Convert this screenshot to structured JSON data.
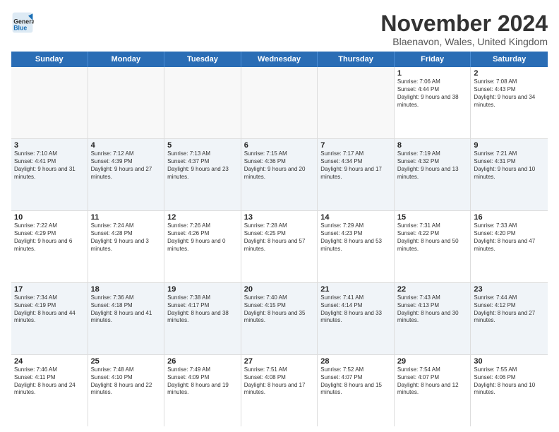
{
  "header": {
    "logo": {
      "general": "General",
      "blue": "Blue"
    },
    "title": "November 2024",
    "location": "Blaenavon, Wales, United Kingdom"
  },
  "calendar": {
    "days": [
      "Sunday",
      "Monday",
      "Tuesday",
      "Wednesday",
      "Thursday",
      "Friday",
      "Saturday"
    ],
    "weeks": [
      [
        {
          "day": "",
          "text": ""
        },
        {
          "day": "",
          "text": ""
        },
        {
          "day": "",
          "text": ""
        },
        {
          "day": "",
          "text": ""
        },
        {
          "day": "",
          "text": ""
        },
        {
          "day": "1",
          "text": "Sunrise: 7:06 AM\nSunset: 4:44 PM\nDaylight: 9 hours and 38 minutes."
        },
        {
          "day": "2",
          "text": "Sunrise: 7:08 AM\nSunset: 4:43 PM\nDaylight: 9 hours and 34 minutes."
        }
      ],
      [
        {
          "day": "3",
          "text": "Sunrise: 7:10 AM\nSunset: 4:41 PM\nDaylight: 9 hours and 31 minutes."
        },
        {
          "day": "4",
          "text": "Sunrise: 7:12 AM\nSunset: 4:39 PM\nDaylight: 9 hours and 27 minutes."
        },
        {
          "day": "5",
          "text": "Sunrise: 7:13 AM\nSunset: 4:37 PM\nDaylight: 9 hours and 23 minutes."
        },
        {
          "day": "6",
          "text": "Sunrise: 7:15 AM\nSunset: 4:36 PM\nDaylight: 9 hours and 20 minutes."
        },
        {
          "day": "7",
          "text": "Sunrise: 7:17 AM\nSunset: 4:34 PM\nDaylight: 9 hours and 17 minutes."
        },
        {
          "day": "8",
          "text": "Sunrise: 7:19 AM\nSunset: 4:32 PM\nDaylight: 9 hours and 13 minutes."
        },
        {
          "day": "9",
          "text": "Sunrise: 7:21 AM\nSunset: 4:31 PM\nDaylight: 9 hours and 10 minutes."
        }
      ],
      [
        {
          "day": "10",
          "text": "Sunrise: 7:22 AM\nSunset: 4:29 PM\nDaylight: 9 hours and 6 minutes."
        },
        {
          "day": "11",
          "text": "Sunrise: 7:24 AM\nSunset: 4:28 PM\nDaylight: 9 hours and 3 minutes."
        },
        {
          "day": "12",
          "text": "Sunrise: 7:26 AM\nSunset: 4:26 PM\nDaylight: 9 hours and 0 minutes."
        },
        {
          "day": "13",
          "text": "Sunrise: 7:28 AM\nSunset: 4:25 PM\nDaylight: 8 hours and 57 minutes."
        },
        {
          "day": "14",
          "text": "Sunrise: 7:29 AM\nSunset: 4:23 PM\nDaylight: 8 hours and 53 minutes."
        },
        {
          "day": "15",
          "text": "Sunrise: 7:31 AM\nSunset: 4:22 PM\nDaylight: 8 hours and 50 minutes."
        },
        {
          "day": "16",
          "text": "Sunrise: 7:33 AM\nSunset: 4:20 PM\nDaylight: 8 hours and 47 minutes."
        }
      ],
      [
        {
          "day": "17",
          "text": "Sunrise: 7:34 AM\nSunset: 4:19 PM\nDaylight: 8 hours and 44 minutes."
        },
        {
          "day": "18",
          "text": "Sunrise: 7:36 AM\nSunset: 4:18 PM\nDaylight: 8 hours and 41 minutes."
        },
        {
          "day": "19",
          "text": "Sunrise: 7:38 AM\nSunset: 4:17 PM\nDaylight: 8 hours and 38 minutes."
        },
        {
          "day": "20",
          "text": "Sunrise: 7:40 AM\nSunset: 4:15 PM\nDaylight: 8 hours and 35 minutes."
        },
        {
          "day": "21",
          "text": "Sunrise: 7:41 AM\nSunset: 4:14 PM\nDaylight: 8 hours and 33 minutes."
        },
        {
          "day": "22",
          "text": "Sunrise: 7:43 AM\nSunset: 4:13 PM\nDaylight: 8 hours and 30 minutes."
        },
        {
          "day": "23",
          "text": "Sunrise: 7:44 AM\nSunset: 4:12 PM\nDaylight: 8 hours and 27 minutes."
        }
      ],
      [
        {
          "day": "24",
          "text": "Sunrise: 7:46 AM\nSunset: 4:11 PM\nDaylight: 8 hours and 24 minutes."
        },
        {
          "day": "25",
          "text": "Sunrise: 7:48 AM\nSunset: 4:10 PM\nDaylight: 8 hours and 22 minutes."
        },
        {
          "day": "26",
          "text": "Sunrise: 7:49 AM\nSunset: 4:09 PM\nDaylight: 8 hours and 19 minutes."
        },
        {
          "day": "27",
          "text": "Sunrise: 7:51 AM\nSunset: 4:08 PM\nDaylight: 8 hours and 17 minutes."
        },
        {
          "day": "28",
          "text": "Sunrise: 7:52 AM\nSunset: 4:07 PM\nDaylight: 8 hours and 15 minutes."
        },
        {
          "day": "29",
          "text": "Sunrise: 7:54 AM\nSunset: 4:07 PM\nDaylight: 8 hours and 12 minutes."
        },
        {
          "day": "30",
          "text": "Sunrise: 7:55 AM\nSunset: 4:06 PM\nDaylight: 8 hours and 10 minutes."
        }
      ]
    ]
  }
}
